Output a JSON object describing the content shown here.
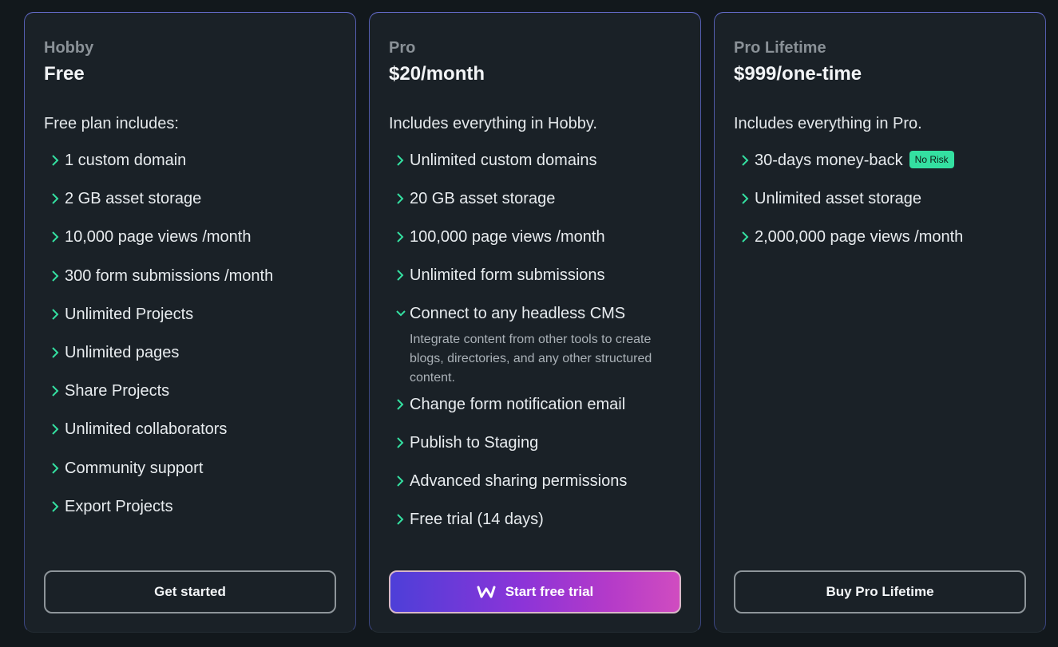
{
  "plans": [
    {
      "tier": "Hobby",
      "price": "Free",
      "intro": "Free plan includes:",
      "features": [
        {
          "label": "1 custom domain"
        },
        {
          "label": "2 GB asset storage"
        },
        {
          "label": "10,000 page views /month"
        },
        {
          "label": "300 form submissions /month"
        },
        {
          "label": "Unlimited Projects"
        },
        {
          "label": "Unlimited pages"
        },
        {
          "label": "Share Projects"
        },
        {
          "label": "Unlimited collaborators"
        },
        {
          "label": "Community support"
        },
        {
          "label": "Export Projects"
        }
      ],
      "button": "Get started"
    },
    {
      "tier": "Pro",
      "price": "$20/month",
      "intro": "Includes everything in Hobby.",
      "features": [
        {
          "label": "Unlimited custom domains"
        },
        {
          "label": "20 GB asset storage"
        },
        {
          "label": "100,000 page views /month"
        },
        {
          "label": "Unlimited form submissions"
        },
        {
          "label": "Connect to any headless CMS",
          "expanded": true,
          "description": "Integrate content from other tools to create blogs, directories, and any other structured content."
        },
        {
          "label": "Change form notification email"
        },
        {
          "label": "Publish to Staging"
        },
        {
          "label": "Advanced sharing permissions"
        },
        {
          "label": "Free trial (14 days)"
        }
      ],
      "button": "Start free trial"
    },
    {
      "tier": "Pro Lifetime",
      "price": "$999/one-time",
      "intro": "Includes everything in Pro.",
      "features": [
        {
          "label": "30-days money-back",
          "badge": "No Risk"
        },
        {
          "label": "Unlimited asset storage"
        },
        {
          "label": "2,000,000 page views /month"
        }
      ],
      "button": "Buy Pro Lifetime"
    }
  ],
  "icons": {
    "collapsed": "chevron-right-icon",
    "expanded": "chevron-down-icon",
    "brand": "webstudio-logo-icon"
  },
  "colors": {
    "accent": "#34e0a1",
    "background": "#12181c",
    "card": "#1a2127"
  }
}
